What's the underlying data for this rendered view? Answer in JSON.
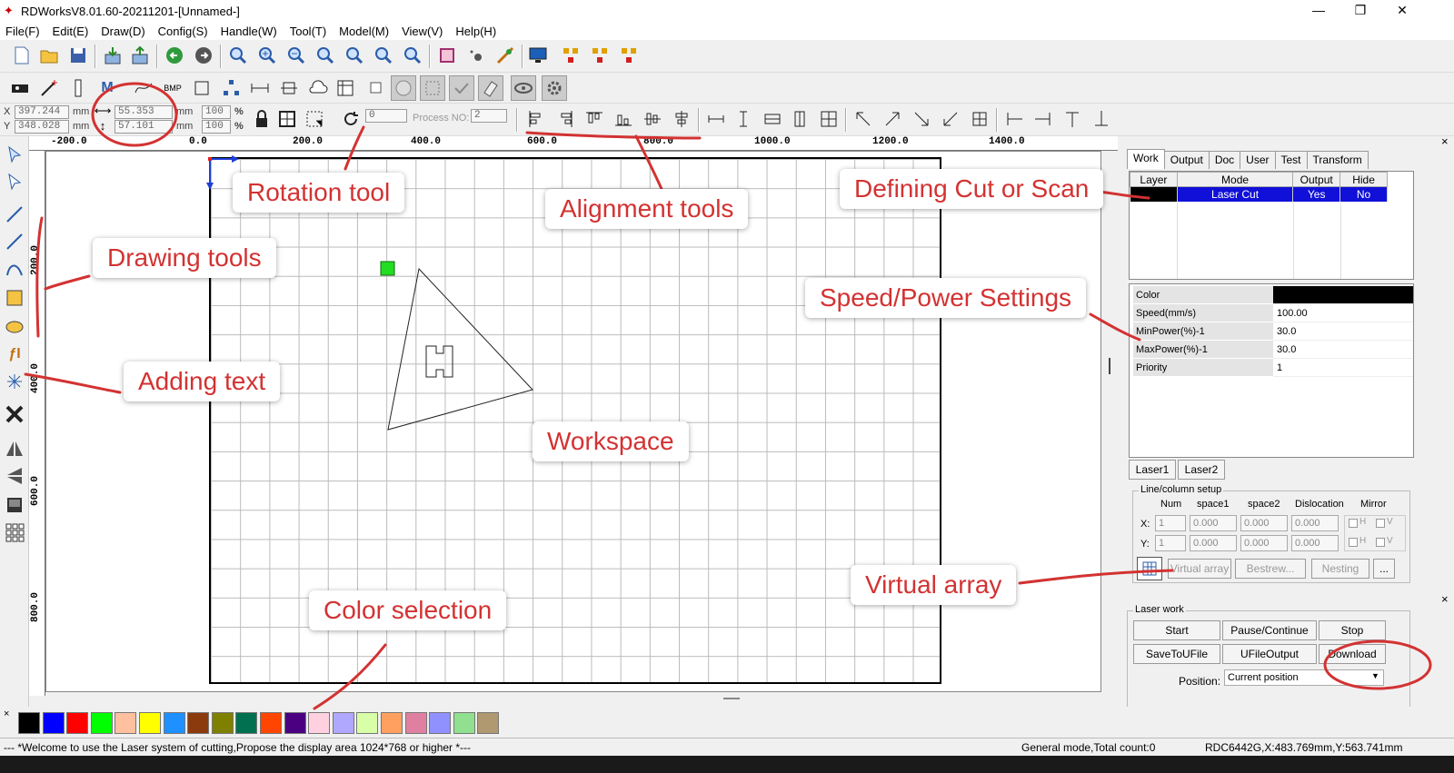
{
  "window": {
    "title": "RDWorksV8.01.60-20211201-[Unnamed-]",
    "minimize": "—",
    "maximize": "❐",
    "close": "✕"
  },
  "menu": [
    "File(F)",
    "Edit(E)",
    "Draw(D)",
    "Config(S)",
    "Handle(W)",
    "Tool(T)",
    "Model(M)",
    "View(V)",
    "Help(H)"
  ],
  "coords": {
    "x_label": "X",
    "y_label": "Y",
    "x_value": "397.244",
    "y_value": "348.028",
    "x_unit": "mm",
    "y_unit": "mm",
    "width_value": "55.353",
    "height_value": "57.101",
    "w_unit": "mm",
    "h_unit": "mm",
    "scale_x": "100",
    "scale_y": "100",
    "pct": "%",
    "rotation": "0",
    "process_label": "Process NO:",
    "process_no": "2"
  },
  "ruler_top": [
    "-200.0",
    "0.0",
    "200.0",
    "400.0",
    "600.0",
    "800.0",
    "1000.0",
    "1200.0",
    "1400.0"
  ],
  "ruler_left": [
    "200.0",
    "400.0",
    "600.0",
    "800.0"
  ],
  "annotations": {
    "rotation": "Rotation tool",
    "alignment": "Alignment tools",
    "cut_scan": "Defining Cut or Scan",
    "drawing": "Drawing tools",
    "speed_power": "Speed/Power Settings",
    "adding_text": "Adding text",
    "workspace": "Workspace",
    "virtual_array": "Virtual array",
    "color_selection": "Color selection",
    "color": "#d33232"
  },
  "panel": {
    "tabs": [
      "Work",
      "Output",
      "Doc",
      "User",
      "Test",
      "Transform"
    ],
    "layer_table": {
      "headers": [
        "Layer",
        "Mode",
        "Output",
        "Hide"
      ],
      "rows": [
        {
          "mode": "Laser Cut",
          "output": "Yes",
          "hide": "No",
          "layer_color": "#000000"
        }
      ]
    },
    "props": [
      {
        "key": "Color",
        "value": ""
      },
      {
        "key": "Speed(mm/s)",
        "value": "100.00"
      },
      {
        "key": "MinPower(%)-1",
        "value": "30.0"
      },
      {
        "key": "MaxPower(%)-1",
        "value": "30.0"
      },
      {
        "key": "Priority",
        "value": "1"
      }
    ],
    "laser_buttons": [
      "Laser1",
      "Laser2"
    ],
    "array": {
      "title": "Line/column setup",
      "headers": [
        "Num",
        "space1",
        "space2",
        "Dislocation",
        "Mirror"
      ],
      "x_label": "X:",
      "y_label": "Y:",
      "x_vals": [
        "1",
        "0.000",
        "0.000",
        "0.000"
      ],
      "y_vals": [
        "1",
        "0.000",
        "0.000",
        "0.000"
      ],
      "h": "H",
      "v": "V",
      "buttons": [
        "Virtual array",
        "Bestrew...",
        "Nesting",
        "..."
      ]
    },
    "laser_work": {
      "title": "Laser work",
      "buttons": [
        "Start",
        "Pause/Continue",
        "Stop",
        "SaveToUFile",
        "UFileOutput",
        "Download"
      ],
      "position_label": "Position:",
      "position_value": "Current position"
    }
  },
  "palette": [
    "#000000",
    "#0000ff",
    "#ff0000",
    "#00ff00",
    "#ffc0a0",
    "#ffff00",
    "#1e90ff",
    "#8b3a0e",
    "#808000",
    "#007050",
    "#ff4500",
    "#4b0082",
    "#ffd0e0",
    "#b0a8ff",
    "#d8ffa8",
    "#ffa060",
    "#e080a0",
    "#9090ff",
    "#90e090",
    "#b09870"
  ],
  "status": {
    "message": "--- *Welcome to use the Laser system of cutting,Propose the display area 1024*768 or higher *---",
    "mode": "General mode,Total count:0",
    "device": "RDC6442G,X:483.769mm,Y:563.741mm"
  }
}
